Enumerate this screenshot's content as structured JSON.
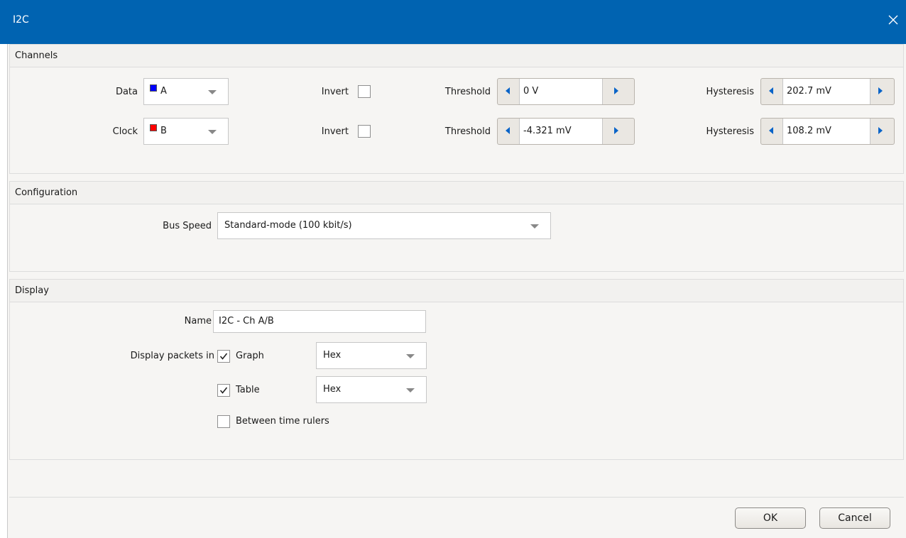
{
  "window": {
    "title": "I2C"
  },
  "channels": {
    "header": "Channels",
    "rows": [
      {
        "label": "Data",
        "channel": "A",
        "color": "#0000ff",
        "invert_label": "Invert",
        "invert_checked": false,
        "threshold_label": "Threshold",
        "threshold_value": "0 V",
        "hysteresis_label": "Hysteresis",
        "hysteresis_value": "202.7 mV"
      },
      {
        "label": "Clock",
        "channel": "B",
        "color": "#ff0000",
        "invert_label": "Invert",
        "invert_checked": false,
        "threshold_label": "Threshold",
        "threshold_value": "-4.321 mV",
        "hysteresis_label": "Hysteresis",
        "hysteresis_value": "108.2 mV"
      }
    ]
  },
  "configuration": {
    "header": "Configuration",
    "bus_speed_label": "Bus Speed",
    "bus_speed_value": "Standard-mode (100 kbit/s)"
  },
  "display": {
    "header": "Display",
    "name_label": "Name",
    "name_value": "I2C - Ch A/B",
    "packets_label": "Display packets in",
    "graph": {
      "label": "Graph",
      "checked": true,
      "format": "Hex"
    },
    "table": {
      "label": "Table",
      "checked": true,
      "format": "Hex"
    },
    "between_rulers": {
      "label": "Between time rulers",
      "checked": false
    }
  },
  "buttons": {
    "ok": "OK",
    "cancel": "Cancel"
  }
}
